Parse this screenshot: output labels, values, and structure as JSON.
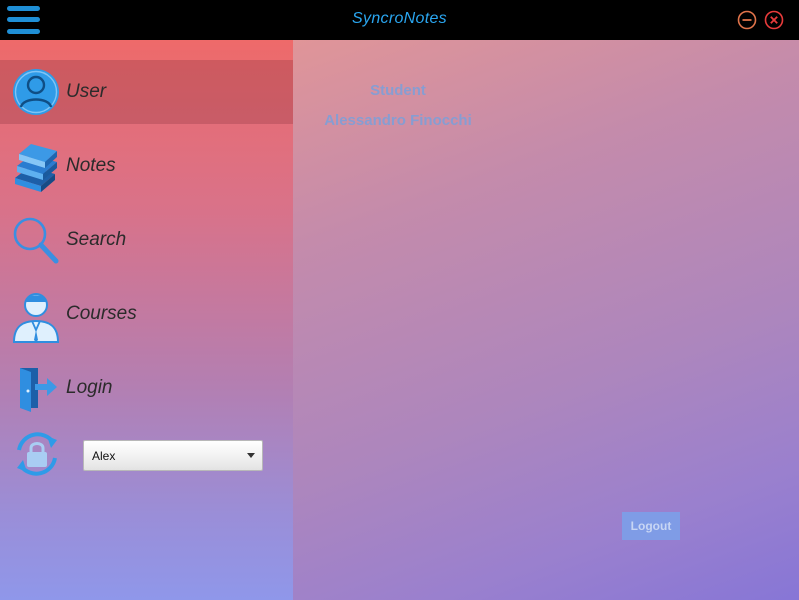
{
  "app": {
    "title": "SyncroNotes",
    "icons": {
      "menu": "hamburger-menu-icon",
      "minimize": "minimize-icon",
      "close": "close-icon"
    }
  },
  "colors": {
    "accent": "#1f8fd6",
    "title_text": "#2aa6f0",
    "minimize": "#e0734a",
    "close": "#e83b3b",
    "icon_blue": "#2f8ee0"
  },
  "sidebar": {
    "items": [
      {
        "label": "User",
        "icon": "user-avatar-icon",
        "active": true
      },
      {
        "label": "Notes",
        "icon": "books-icon",
        "active": false
      },
      {
        "label": "Search",
        "icon": "magnifier-icon",
        "active": false
      },
      {
        "label": "Courses",
        "icon": "teacher-icon",
        "active": false
      },
      {
        "label": "Login",
        "icon": "door-exit-icon",
        "active": false
      }
    ],
    "sync": {
      "icon": "sync-lock-icon",
      "selected": "Alex"
    }
  },
  "main": {
    "role": "Student",
    "name": "Alessandro Finocchi",
    "logout_label": "Logout"
  }
}
